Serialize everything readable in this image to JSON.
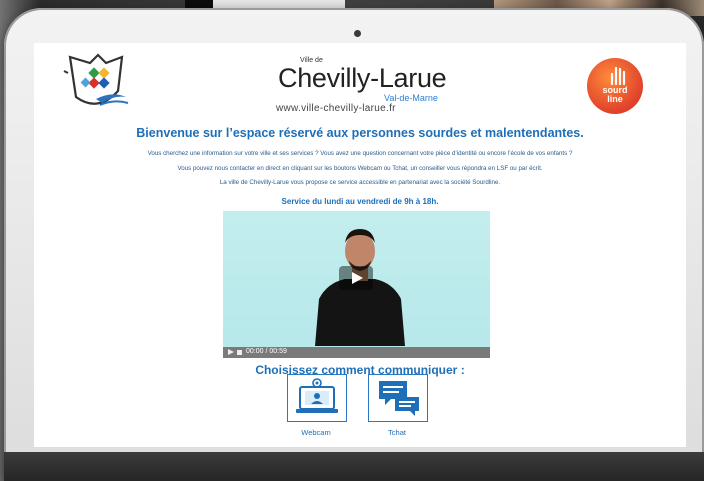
{
  "header": {
    "ville_label": "Ville de",
    "city_name": "Chevilly-Larue",
    "department": "Val-de-Marne",
    "website": "www.ville-chevilly-larue.fr",
    "partner_logo_text": [
      "sourd",
      "line"
    ]
  },
  "main": {
    "title": "Bienvenue sur l’espace réservé aux personnes sourdes et malentendantes.",
    "paragraphs": [
      "Vous cherchez une information sur votre ville et ses services ? Vous avez une question concernant votre pièce d’identité ou encore l’école de vos enfants ?",
      "Vous pouvez nous contacter en direct en cliquant sur les boutons Webcam ou Tchat, un conseiller vous répondra en LSF ou par écrit.",
      "La ville de Chevilly-Larue vous propose ce service accessible en partenariat avec la société Sourdline."
    ],
    "service_hours": "Service du lundi au vendredi de 9h à 18h."
  },
  "video": {
    "time_display": "00:00 / 00:59",
    "progress": 0
  },
  "contact": {
    "heading": "Choisissez comment communiquer :",
    "options": [
      {
        "label": "Webcam",
        "icon": "webcam-laptop-icon"
      },
      {
        "label": "Tchat",
        "icon": "chat-bubbles-icon"
      }
    ]
  },
  "colors": {
    "accent_blue": "#1e6fb8",
    "paragraph_blue": "#2b5b8a",
    "sourdline_orange": "#e0422b",
    "video_bg": "#c3eeee"
  }
}
